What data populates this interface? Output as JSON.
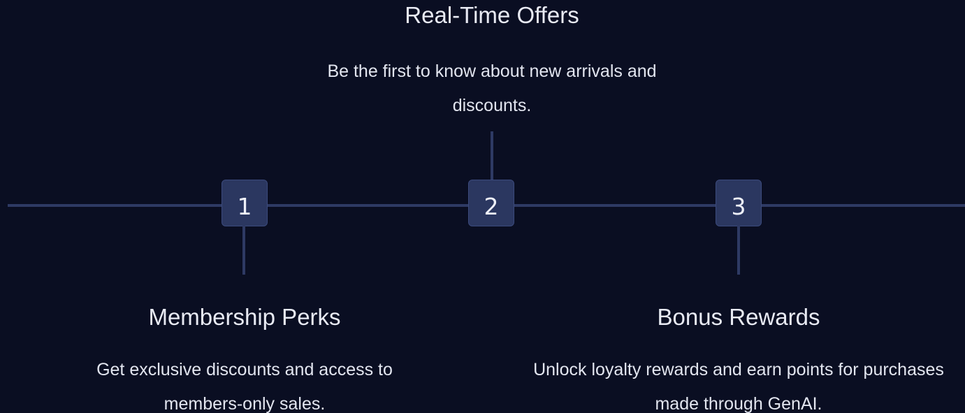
{
  "steps": [
    {
      "number": "1",
      "title": "Membership Perks",
      "description": "Get exclusive discounts and access to members-only sales."
    },
    {
      "number": "2",
      "title": "Real-Time Offers",
      "description": "Be the first to know about new arrivals and discounts."
    },
    {
      "number": "3",
      "title": "Bonus Rewards",
      "description": "Unlock loyalty rewards and earn points for purchases made through GenAI."
    }
  ],
  "colors": {
    "background": "#0a0e22",
    "connector": "#2e3a64",
    "step_box": "#2b3760",
    "text": "#e8eaf3"
  }
}
